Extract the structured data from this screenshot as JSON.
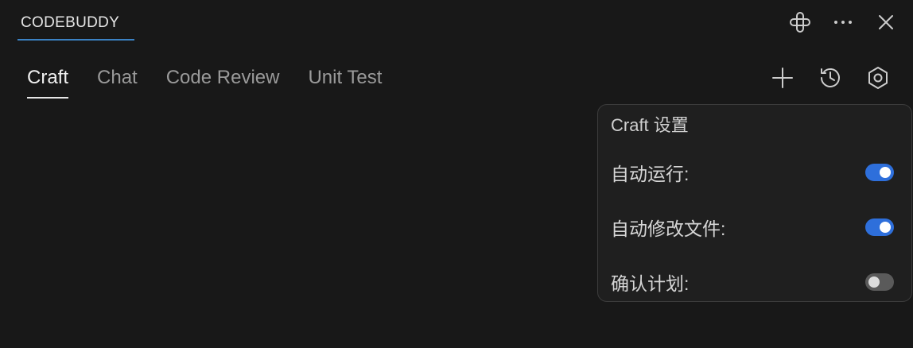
{
  "panel": {
    "title": "CODEBUDDY",
    "icons": [
      "grid-icon",
      "more-icon",
      "close-icon"
    ]
  },
  "tabs": [
    {
      "label": "Craft",
      "active": true
    },
    {
      "label": "Chat",
      "active": false
    },
    {
      "label": "Code Review",
      "active": false
    },
    {
      "label": "Unit Test",
      "active": false
    }
  ],
  "tab_actions": [
    "add-icon",
    "history-icon",
    "settings-icon"
  ],
  "popup": {
    "title": "Craft 设置",
    "settings": [
      {
        "label": "自动运行:",
        "enabled": true
      },
      {
        "label": "自动修改文件:",
        "enabled": true
      },
      {
        "label": "确认计划:",
        "enabled": false
      }
    ]
  },
  "colors": {
    "background": "#181818",
    "accent": "#2e6fdb",
    "underline": "#3b82c4"
  }
}
